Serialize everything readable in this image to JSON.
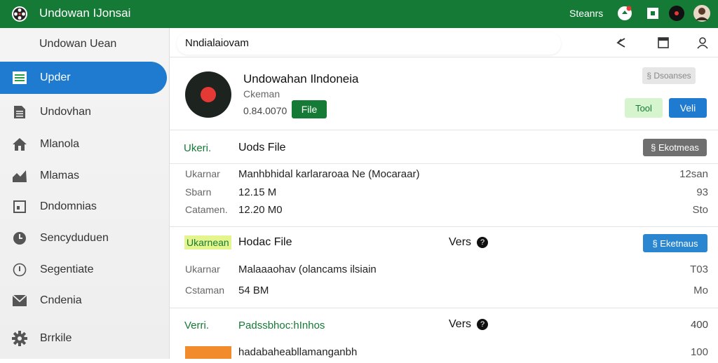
{
  "colors": {
    "topbar": "#157a36",
    "accent_blue": "#1e7bcf",
    "green": "#157a36",
    "light_green": "#d6f5cf",
    "yellow_tag": "#e5f58e",
    "orange": "#f28b2c"
  },
  "header": {
    "app_title": "Undowan IJonsai",
    "right_label": "Steanrs",
    "icons": [
      "film-reel-logo",
      "notification-icon",
      "square-icon",
      "record-icon",
      "user-avatar"
    ]
  },
  "sidebar": {
    "heading": "Undowan Uean",
    "items": [
      {
        "label": "Upder",
        "icon": "list-icon",
        "active": true
      },
      {
        "label": "Undovhan",
        "icon": "document-icon",
        "active": false
      },
      {
        "label": "Mlanola",
        "icon": "home-icon",
        "active": false
      },
      {
        "label": "Mlamas",
        "icon": "chart-icon",
        "active": false
      },
      {
        "label": "Dndomnias",
        "icon": "folder-icon",
        "active": false
      },
      {
        "label": "Sencyduduen",
        "icon": "clock-icon",
        "active": false
      },
      {
        "label": "Segentiate",
        "icon": "info-circle-icon",
        "active": false
      },
      {
        "label": "Cndenia",
        "icon": "mail-icon",
        "active": false
      },
      {
        "label": "Brrkile",
        "icon": "gear-icon",
        "active": false
      }
    ]
  },
  "toolbar": {
    "breadcrumb": "Nndialaiovam",
    "icons": [
      "back-arrow-icon",
      "square-icon",
      "user-icon"
    ]
  },
  "card": {
    "title": "Undowahan Ilndoneia",
    "subtitle": "Ckeman",
    "number": "0.84.0070",
    "file_button": "File",
    "top_button": "§ Dsoanses",
    "tool_button": "Tool",
    "veli_button": "Veli"
  },
  "sections": [
    {
      "tag": "Ukeri.",
      "title": "Uods File",
      "action": "§ Ekotmeas",
      "rows": [
        {
          "key": "Ukarnar",
          "value": "Manhbhidal karlararoaa Ne (Mocaraar)",
          "right": "12san"
        },
        {
          "key": "Sbarn",
          "value": "12.15 M",
          "right": "93"
        },
        {
          "key": "Catamen.",
          "value": "12.20 M0",
          "right": "Sto"
        }
      ]
    },
    {
      "tag": "Ukarnean",
      "title": "Hodac File",
      "vers": "Vers",
      "action": "§ Eketnaus",
      "rows": [
        {
          "key": "Ukarnar",
          "value": "Malaaaohav (olancams ilsiain",
          "right": "T03"
        },
        {
          "key": "Cstaman",
          "value": "54 BM",
          "right": "Mo"
        }
      ]
    },
    {
      "tag": "Verri.",
      "title": "Padssbhoc:hInhos",
      "vers": "Vers",
      "right": "400"
    },
    {
      "value": "hadabaheabllamanganbh",
      "right": "100"
    }
  ]
}
